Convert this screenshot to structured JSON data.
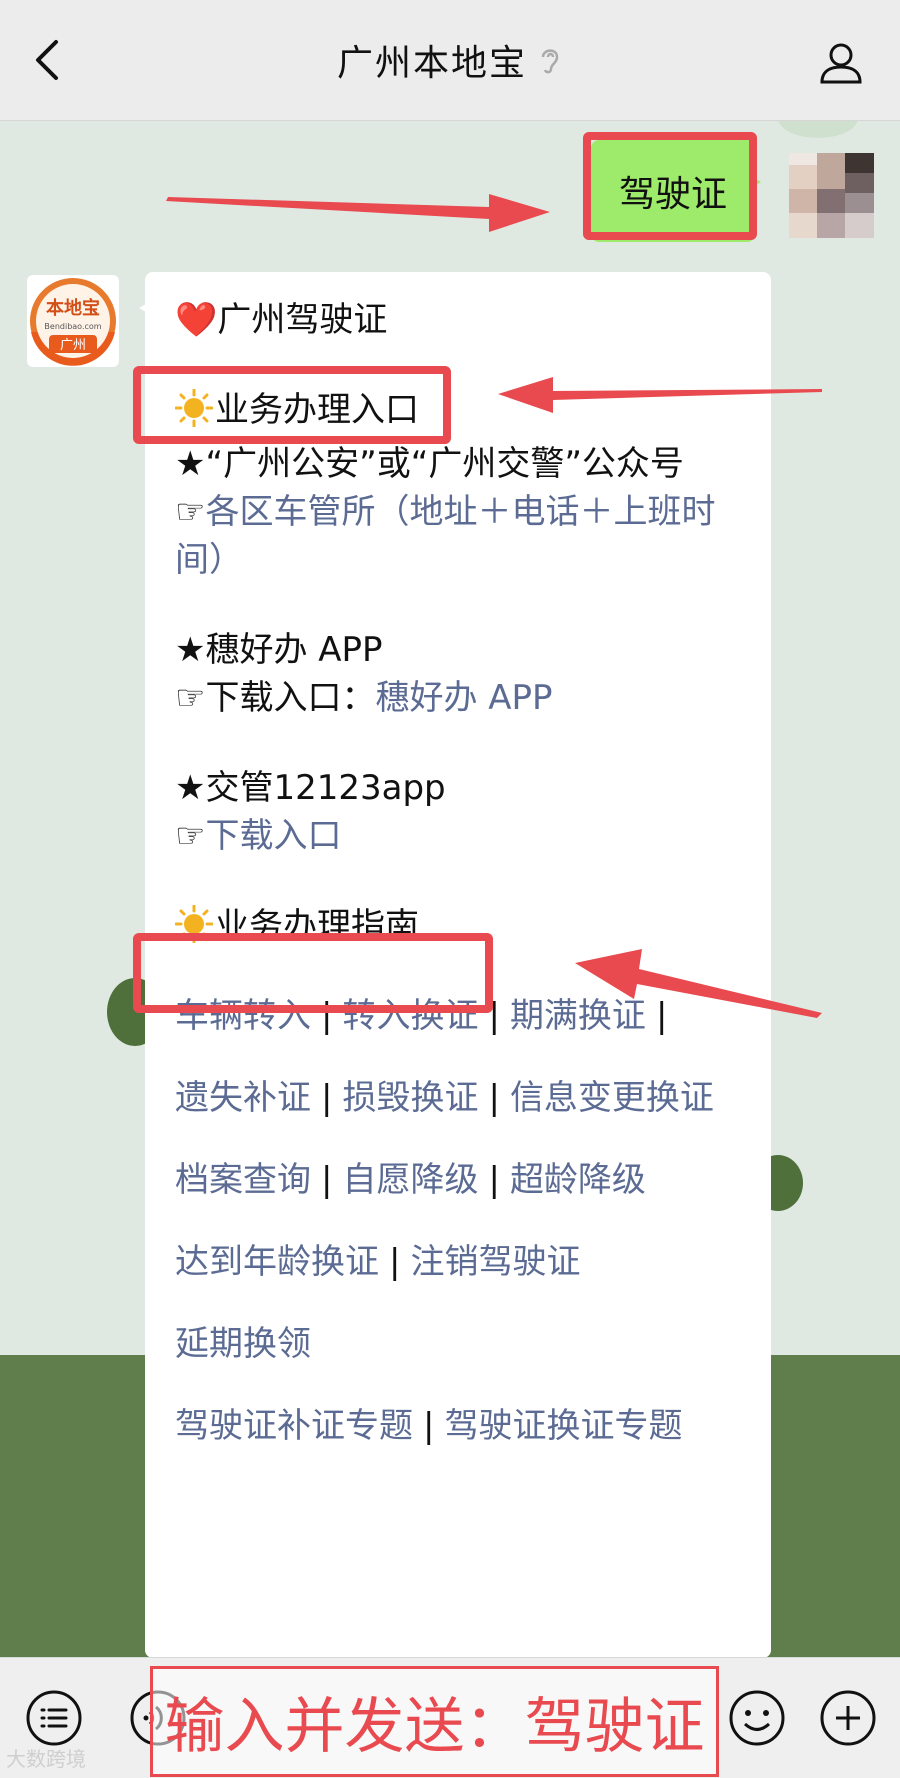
{
  "header": {
    "title": "广州本地宝"
  },
  "chat": {
    "sent_message": "驾驶证",
    "bot_logo": {
      "line1": "本地宝",
      "line2": "Bendibao.com",
      "line3": "广州"
    },
    "response": {
      "title_emoji": "❤️",
      "title": "广州驾驶证",
      "section1_icon": "sun",
      "section1_title": "业务办理入口",
      "item1_title": "★“广州公安”或“广州交警”公众号",
      "item1_link_prefix": "☞",
      "item1_link": "各区车管所（地址＋电话＋上班时间）",
      "item2_title": "★穗好办 APP",
      "item2_prefix": "☞下载入口：",
      "item2_link": "穗好办 APP",
      "item3_title": "★交管12123app",
      "item3_link_prefix": "☞",
      "item3_link": "下载入口",
      "section2_title": "业务办理指南",
      "guide_lines": [
        [
          "车辆转入",
          "|",
          "转入换证",
          "|",
          "期满换证",
          "|"
        ],
        [
          "遗失补证",
          "|",
          "损毁换证",
          "|",
          "信息变更换证"
        ],
        [
          "档案查询",
          "|",
          "自愿降级",
          "|",
          "超龄降级"
        ],
        [
          "达到年龄换证",
          "|",
          "注销驾驶证"
        ],
        [
          "延期换领"
        ],
        [
          "驾驶证补证专题",
          "|",
          "驾驶证换证专题"
        ]
      ]
    }
  },
  "overlay": {
    "instruction": "输入并发送：驾驶证",
    "watermark": "大数跨境"
  }
}
